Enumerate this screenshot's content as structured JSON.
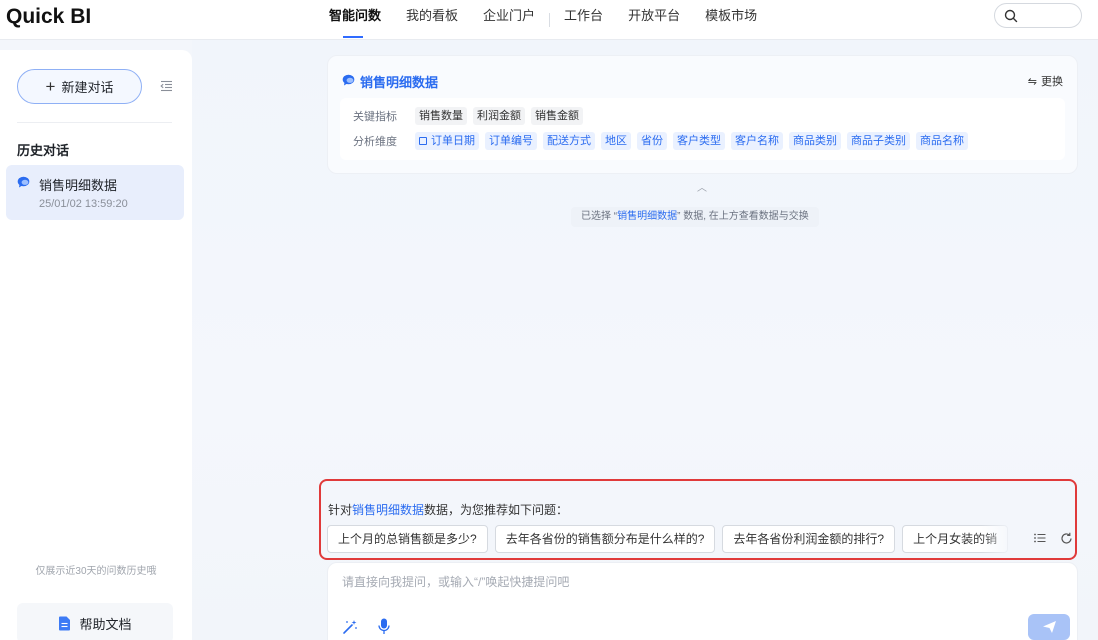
{
  "app": {
    "logo": "Quick BI"
  },
  "nav": {
    "items": [
      {
        "label": "智能问数",
        "active": true
      },
      {
        "label": "我的看板"
      },
      {
        "label": "企业门户"
      },
      {
        "label": "工作台"
      },
      {
        "label": "开放平台"
      },
      {
        "label": "模板市场"
      }
    ]
  },
  "sidebar": {
    "new_chat_label": "新建对话",
    "history_title": "历史对话",
    "history": [
      {
        "title": "销售明细数据",
        "time": "25/01/02 13:59:20"
      }
    ],
    "history_note": "仅展示近30天的问数历史哦",
    "help_label": "帮助文档"
  },
  "dataset": {
    "title": "销售明细数据",
    "swap_label": "更换",
    "metrics_label": "关键指标",
    "metrics": [
      "销售数量",
      "利润金额",
      "销售金额"
    ],
    "dimensions_label": "分析维度",
    "dimensions": [
      "订单日期",
      "订单编号",
      "配送方式",
      "地区",
      "省份",
      "客户类型",
      "客户名称",
      "商品类别",
      "商品子类别",
      "商品名称"
    ]
  },
  "selected_note": {
    "prefix": "已选择 “",
    "name": "销售明细数据",
    "suffix": "” 数据, 在上方查看数据与交换"
  },
  "recommend": {
    "intro_prefix": "针对",
    "intro_name": "销售明细数据",
    "intro_suffix": "数据，为您推荐如下问题：",
    "questions": [
      "上个月的总销售额是多少?",
      "去年各省份的销售额分布是什么样的?",
      "去年各省份利润金额的排行?",
      "上个月女装的销"
    ]
  },
  "input": {
    "placeholder": "请直接向我提问，或输入“/”唤起快捷提问吧"
  },
  "colors": {
    "accent": "#2b6cf0",
    "highlight_border": "#e03a3a"
  }
}
